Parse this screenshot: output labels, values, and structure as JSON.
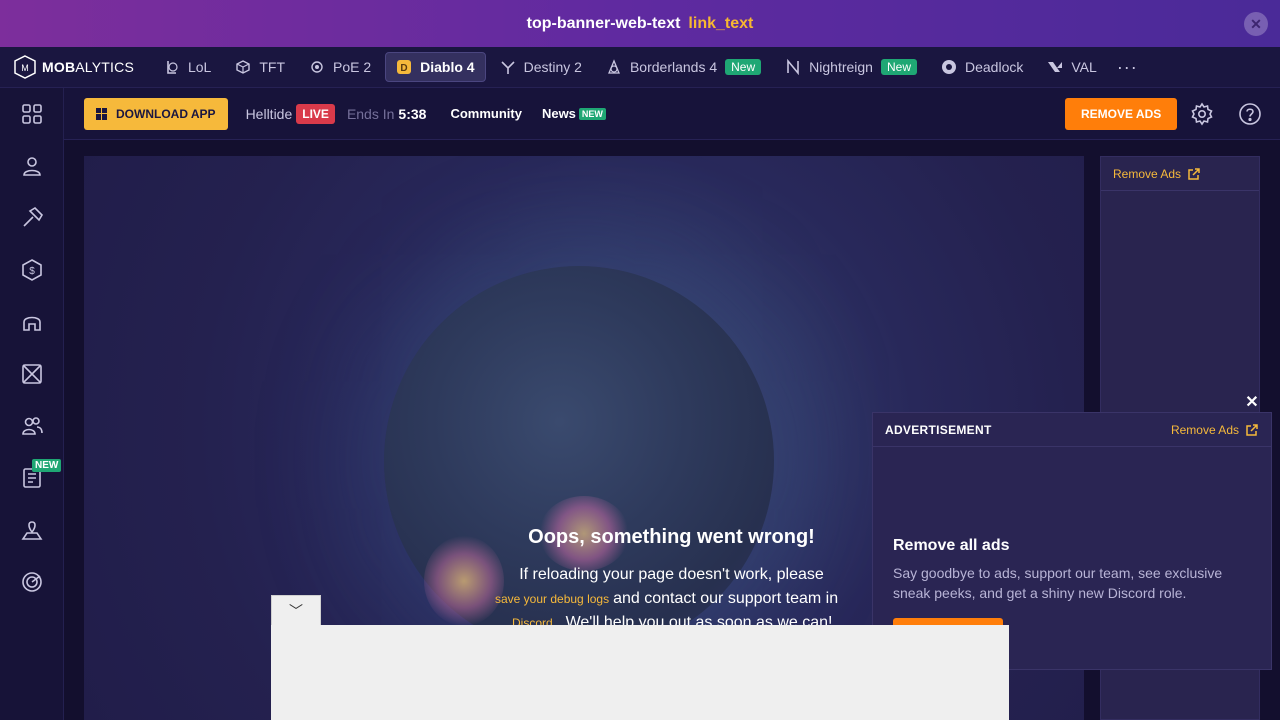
{
  "banner": {
    "text": "top-banner-web-text",
    "link": "link_text",
    "close": "✕"
  },
  "logo": {
    "bold": "MOB",
    "bold2": "ALYTICS"
  },
  "games": [
    {
      "label": "LoL",
      "icon": "lol-icon"
    },
    {
      "label": "TFT",
      "icon": "tft-icon"
    },
    {
      "label": "PoE 2",
      "icon": "poe-icon"
    },
    {
      "label": "Diablo 4",
      "icon": "diablo-icon",
      "active": true
    },
    {
      "label": "Destiny 2",
      "icon": "destiny-icon"
    },
    {
      "label": "Borderlands 4",
      "icon": "borderlands-icon",
      "badge": "New"
    },
    {
      "label": "Nightreign",
      "icon": "nightreign-icon",
      "badge": "New"
    },
    {
      "label": "Deadlock",
      "icon": "deadlock-icon"
    },
    {
      "label": "VAL",
      "icon": "valorant-icon"
    }
  ],
  "more": "···",
  "subheader": {
    "download": "DOWNLOAD APP",
    "helltide": "Helltide",
    "live": "LIVE",
    "ends": "Ends In",
    "time": "5:38",
    "community": "Community",
    "news": "News",
    "news_badge": "NEW",
    "remove_ads": "REMOVE ADS"
  },
  "sidebar": {
    "new_badge": "NEW"
  },
  "error": {
    "title": "Oops, something went wrong!",
    "line1": "If reloading your page doesn't work, please",
    "debug_link": "save your debug logs",
    "line2": "and contact our support team in",
    "discord_link": "Discord",
    "line3": ". We'll help you out as soon as we can!"
  },
  "rail": {
    "remove_ads": "Remove Ads"
  },
  "float_ad": {
    "close": "✕",
    "label": "ADVERTISEMENT",
    "remove_ads": "Remove Ads",
    "title": "Remove all ads",
    "desc": "Say goodbye to ads, support our team, see exclusive sneak peeks, and get a shiny new Discord role."
  },
  "bottom_ad": {
    "collapse": "﹀"
  },
  "colors": {
    "accent": "#f6b93b",
    "orange": "#ff7e0a",
    "green": "#1fa774",
    "live": "#d93a4a"
  }
}
